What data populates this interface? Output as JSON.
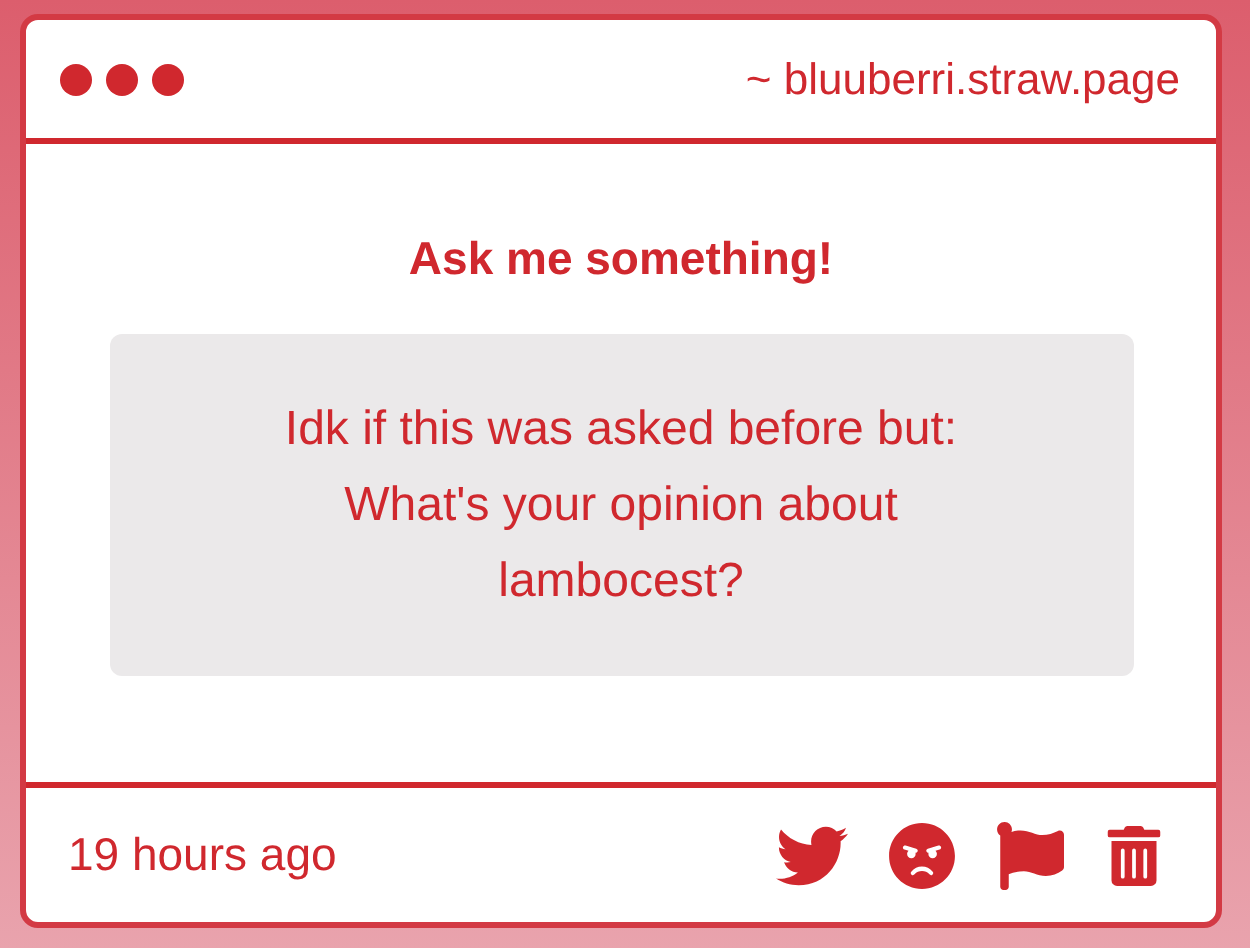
{
  "window": {
    "url": "~ bluuberri.straw.page"
  },
  "prompt": "Ask me something!",
  "question": "Idk if this was asked before but: What's your opinion about lambocest?",
  "footer": {
    "time": "19 hours ago",
    "actions": [
      {
        "kind": "share"
      },
      {
        "kind": "react"
      },
      {
        "kind": "report"
      },
      {
        "kind": "delete"
      }
    ]
  }
}
